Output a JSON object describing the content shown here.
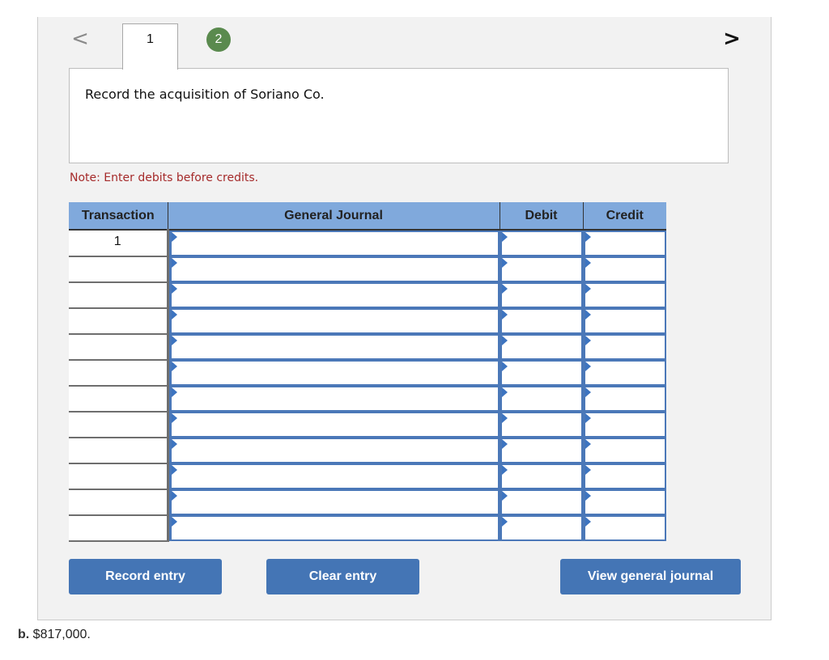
{
  "navigation": {
    "prev_icon": "chevron-left-icon",
    "next_icon": "chevron-right-icon",
    "prev_glyph": "<",
    "next_glyph": ">",
    "tabs": [
      {
        "label": "1",
        "active": true
      },
      {
        "label": "2",
        "active": false,
        "completed": true,
        "color": "#5a8a4e"
      }
    ]
  },
  "question": {
    "text": "Record the acquisition of Soriano Co."
  },
  "note": "Note: Enter debits before credits.",
  "journal": {
    "headers": [
      "Transaction",
      "General Journal",
      "Debit",
      "Credit"
    ],
    "rows": [
      {
        "transaction": "1",
        "account": "",
        "debit": "",
        "credit": ""
      },
      {
        "transaction": "",
        "account": "",
        "debit": "",
        "credit": ""
      },
      {
        "transaction": "",
        "account": "",
        "debit": "",
        "credit": ""
      },
      {
        "transaction": "",
        "account": "",
        "debit": "",
        "credit": ""
      },
      {
        "transaction": "",
        "account": "",
        "debit": "",
        "credit": ""
      },
      {
        "transaction": "",
        "account": "",
        "debit": "",
        "credit": ""
      },
      {
        "transaction": "",
        "account": "",
        "debit": "",
        "credit": ""
      },
      {
        "transaction": "",
        "account": "",
        "debit": "",
        "credit": ""
      },
      {
        "transaction": "",
        "account": "",
        "debit": "",
        "credit": ""
      },
      {
        "transaction": "",
        "account": "",
        "debit": "",
        "credit": ""
      },
      {
        "transaction": "",
        "account": "",
        "debit": "",
        "credit": ""
      },
      {
        "transaction": "",
        "account": "",
        "debit": "",
        "credit": ""
      }
    ]
  },
  "buttons": {
    "record": "Record entry",
    "clear": "Clear entry",
    "view": "View general journal"
  },
  "colors": {
    "header_bg": "#80a9dc",
    "button_bg": "#4475b5",
    "note_color": "#a52a2a",
    "input_border": "#4b78b8"
  },
  "answer": {
    "label": "b.",
    "value": "$817,000."
  }
}
